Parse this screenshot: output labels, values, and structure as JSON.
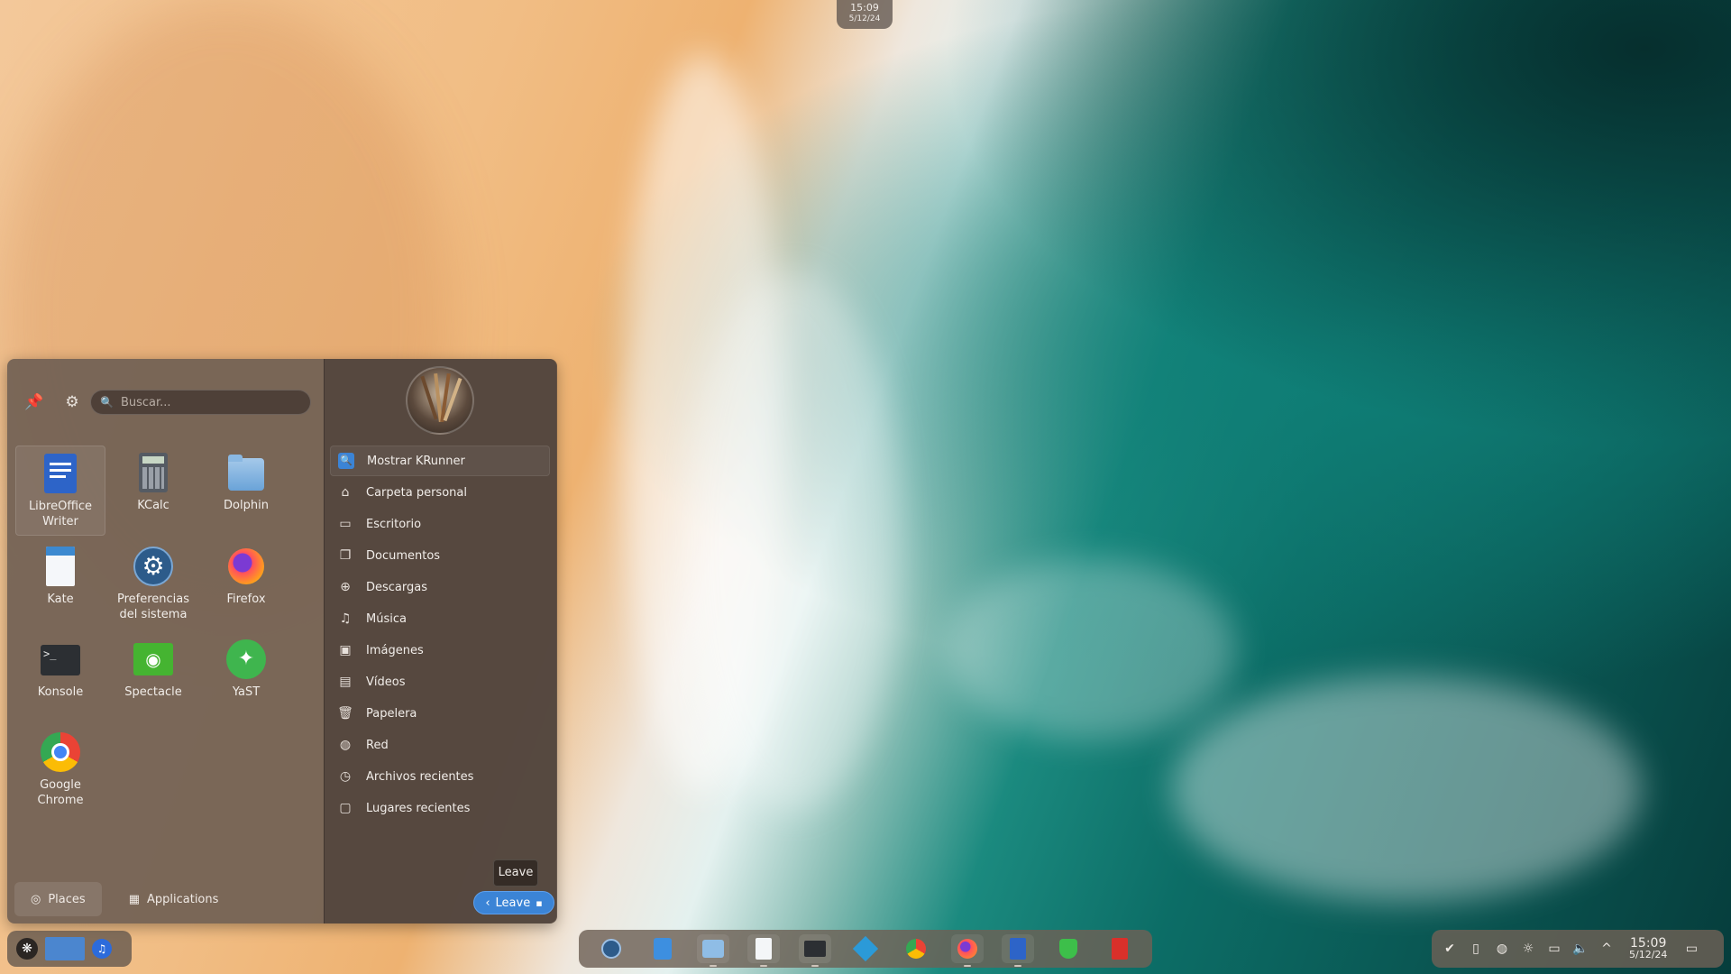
{
  "top_clock": {
    "time": "15:09",
    "date": "5/12/24"
  },
  "launcher": {
    "search_placeholder": "Buscar...",
    "apps": [
      {
        "name": "LibreOffice\nWriter",
        "line1": "LibreOffice",
        "line2": "Writer",
        "icon": "libreoffice-writer-icon"
      },
      {
        "line1": "KCalc",
        "line2": "",
        "icon": "kcalc-icon"
      },
      {
        "line1": "Dolphin",
        "line2": "",
        "icon": "dolphin-icon"
      },
      {
        "line1": "Kate",
        "line2": "",
        "icon": "kate-icon"
      },
      {
        "line1": "Preferencias",
        "line2": "del sistema",
        "icon": "system-settings-icon"
      },
      {
        "line1": "Firefox",
        "line2": "",
        "icon": "firefox-icon"
      },
      {
        "line1": "Konsole",
        "line2": "",
        "icon": "konsole-icon"
      },
      {
        "line1": "Spectacle",
        "line2": "",
        "icon": "spectacle-icon"
      },
      {
        "line1": "YaST",
        "line2": "",
        "icon": "yast-icon"
      },
      {
        "line1": "Google",
        "line2": "Chrome",
        "icon": "chrome-icon"
      }
    ],
    "tabs": {
      "places": "Places",
      "applications": "Applications"
    },
    "places": [
      "Mostrar KRunner",
      "Carpeta personal",
      "Escritorio",
      "Documentos",
      "Descargas",
      "Música",
      "Imágenes",
      "Vídeos",
      "Papelera",
      "Red",
      "Archivos recientes",
      "Lugares recientes"
    ],
    "leave_tooltip": "Leave",
    "leave_button": "Leave"
  },
  "tray_clock": {
    "time": "15:09",
    "date": "5/12/24"
  },
  "colors": {
    "accent": "#3b84d6",
    "panel": "#706054"
  }
}
